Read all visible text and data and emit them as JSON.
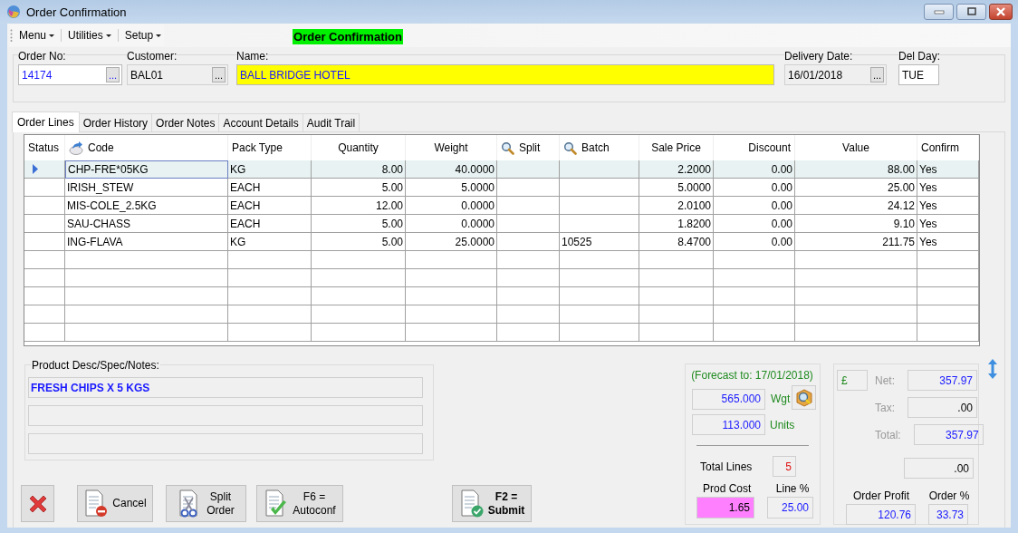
{
  "window": {
    "title": "Order Confirmation"
  },
  "menu": [
    {
      "label": "Menu"
    },
    {
      "label": "Utilities"
    },
    {
      "label": "Setup"
    }
  ],
  "banner": "Order Confirmation",
  "fields": [
    {
      "label": "Order No:",
      "value": "14174",
      "kind": "lookup",
      "browse": "...",
      "readonly": false,
      "highlight": false
    },
    {
      "label": "Customer:",
      "value": "BAL01",
      "kind": "lookup",
      "browse": "...",
      "readonly": true,
      "highlight": false
    },
    {
      "label": "Name:",
      "value": "BALL BRIDGE HOTEL",
      "kind": "text",
      "readonly": false,
      "highlight": true
    },
    {
      "label": "Delivery Date:",
      "value": "16/01/2018",
      "kind": "lookup",
      "browse": "...",
      "readonly": true,
      "highlight": false
    },
    {
      "label": "Del Day:",
      "value": "TUE",
      "kind": "text",
      "readonly": false,
      "highlight": false
    }
  ],
  "tabs": [
    {
      "label": "Order Lines",
      "selected": true
    },
    {
      "label": "Order History",
      "selected": false
    },
    {
      "label": "Order Notes",
      "selected": false
    },
    {
      "label": "Account Details",
      "selected": false
    },
    {
      "label": "Audit Trail",
      "selected": false
    }
  ],
  "table": {
    "columns": [
      {
        "label": "Status",
        "kind": "plain"
      },
      {
        "label": "Code",
        "kind": "action"
      },
      {
        "label": "Pack Type",
        "kind": "plain"
      },
      {
        "label": "Quantity",
        "kind": "plain"
      },
      {
        "label": "Weight",
        "kind": "plain"
      },
      {
        "label": "Split",
        "kind": "lookup"
      },
      {
        "label": "Batch",
        "kind": "lookup"
      },
      {
        "label": "Sale Price",
        "kind": "plain"
      },
      {
        "label": "Discount",
        "kind": "plain"
      },
      {
        "label": "Value",
        "kind": "plain"
      },
      {
        "label": "Confirm",
        "kind": "plain"
      }
    ],
    "rows": [
      {
        "selected": true,
        "cells": [
          "",
          "CHP-FRE*05KG",
          "KG",
          "8.00",
          "40.0000",
          "",
          "",
          "2.2000",
          "0.00",
          "88.00",
          "Yes"
        ]
      },
      {
        "selected": false,
        "cells": [
          "",
          "IRISH_STEW",
          "EACH",
          "5.00",
          "5.0000",
          "",
          "",
          "5.0000",
          "0.00",
          "25.00",
          "Yes"
        ]
      },
      {
        "selected": false,
        "cells": [
          "",
          "MIS-COLE_2.5KG",
          "EACH",
          "12.00",
          "0.0000",
          "",
          "",
          "2.0100",
          "0.00",
          "24.12",
          "Yes"
        ]
      },
      {
        "selected": false,
        "cells": [
          "",
          "SAU-CHASS",
          "EACH",
          "5.00",
          "0.0000",
          "",
          "",
          "1.8200",
          "0.00",
          "9.10",
          "Yes"
        ]
      },
      {
        "selected": false,
        "cells": [
          "",
          "ING-FLAVA",
          "KG",
          "5.00",
          "25.0000",
          "",
          "10525",
          "8.4700",
          "0.00",
          "211.75",
          "Yes"
        ]
      }
    ]
  },
  "notes": {
    "label": "Product Desc/Spec/Notes:",
    "lines": [
      "FRESH CHIPS X 5 KGS"
    ]
  },
  "buttons": [
    {
      "kind": "delete"
    },
    {
      "kind": "cancel",
      "lines": [
        "Cancel"
      ]
    },
    {
      "kind": "split",
      "lines": [
        "Split",
        "Order"
      ]
    },
    {
      "kind": "autoconf",
      "lines": [
        "F6 =",
        "Autoconf"
      ]
    },
    {
      "kind": "submit",
      "lines": [
        "F2 =",
        "Submit"
      ]
    }
  ],
  "forecast": {
    "caption": "(Forecast to: 17/01/2018)",
    "weight": "565.000",
    "weight_label": "Wgt",
    "units": "113.000",
    "units_label": "Units",
    "total_lines_label": "Total Lines",
    "total_lines": "5",
    "prod_cost_label": "Prod Cost",
    "prod_cost": "1.65",
    "line_pct_label": "Line %",
    "line_pct": "25.00"
  },
  "totals": {
    "currency": "£",
    "net_label": "Net:",
    "net": "357.97",
    "tax_label": "Tax:",
    "tax": ".00",
    "total_label": "Total:",
    "total": "357.97",
    "extra": ".00",
    "order_profit_label": "Order Profit",
    "order_profit": "120.76",
    "order_pct_label": "Order %",
    "order_pct": "33.73"
  }
}
